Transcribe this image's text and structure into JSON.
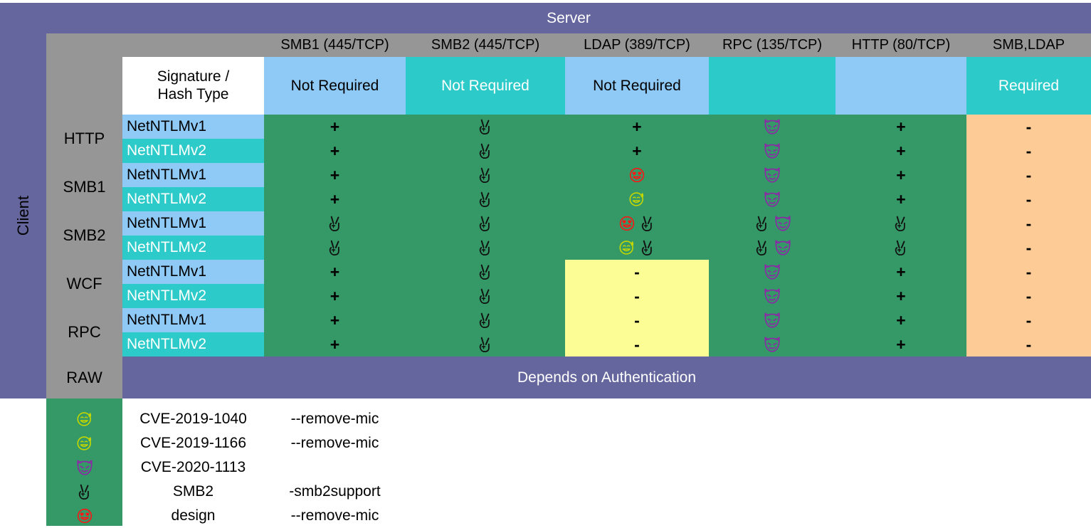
{
  "title": {
    "server": "Server",
    "client": "Client"
  },
  "columns": [
    {
      "name": "SMB1 (445/TCP)",
      "signature": "Not Required",
      "sig_style": "blue"
    },
    {
      "name": "SMB2 (445/TCP)",
      "signature": "Not Required",
      "sig_style": "teal"
    },
    {
      "name": "LDAP (389/TCP)",
      "signature": "Not Required",
      "sig_style": "blue"
    },
    {
      "name": "RPC (135/TCP)",
      "signature": "",
      "sig_style": "teal"
    },
    {
      "name": "HTTP (80/TCP)",
      "signature": "",
      "sig_style": "blue"
    },
    {
      "name": "SMB,LDAP",
      "signature": "Required",
      "sig_style": "teal"
    }
  ],
  "corner_header": {
    "line1": "Signature /",
    "line2": "Hash Type"
  },
  "row_groups": [
    {
      "label": "HTTP"
    },
    {
      "label": "SMB1"
    },
    {
      "label": "SMB2"
    },
    {
      "label": "WCF"
    },
    {
      "label": "RPC"
    },
    {
      "label": "RAW"
    }
  ],
  "hash_types": [
    "NetNTLMv1",
    "NetNTLMv2"
  ],
  "raw_row": {
    "label": "RAW",
    "text": "Depends on Authentication"
  },
  "matrix": [
    {
      "client": "HTTP",
      "hash": "NetNTLMv1",
      "cells": [
        [
          "plus"
        ],
        [
          "hand"
        ],
        [
          "plus"
        ],
        [
          "devil"
        ],
        [
          "plus"
        ],
        [
          "minus"
        ]
      ]
    },
    {
      "client": "HTTP",
      "hash": "NetNTLMv2",
      "cells": [
        [
          "plus"
        ],
        [
          "hand"
        ],
        [
          "plus"
        ],
        [
          "devil"
        ],
        [
          "plus"
        ],
        [
          "minus"
        ]
      ]
    },
    {
      "client": "SMB1",
      "hash": "NetNTLMv1",
      "cells": [
        [
          "plus"
        ],
        [
          "hand"
        ],
        [
          "heart"
        ],
        [
          "devil"
        ],
        [
          "plus"
        ],
        [
          "minus"
        ]
      ]
    },
    {
      "client": "SMB1",
      "hash": "NetNTLMv2",
      "cells": [
        [
          "plus"
        ],
        [
          "hand"
        ],
        [
          "sweat"
        ],
        [
          "devil"
        ],
        [
          "plus"
        ],
        [
          "minus"
        ]
      ]
    },
    {
      "client": "SMB2",
      "hash": "NetNTLMv1",
      "cells": [
        [
          "hand"
        ],
        [
          "hand"
        ],
        [
          "heart",
          "hand"
        ],
        [
          "hand",
          "devil"
        ],
        [
          "hand"
        ],
        [
          "minus"
        ]
      ]
    },
    {
      "client": "SMB2",
      "hash": "NetNTLMv2",
      "cells": [
        [
          "hand"
        ],
        [
          "hand"
        ],
        [
          "sweat",
          "hand"
        ],
        [
          "hand",
          "devil"
        ],
        [
          "hand"
        ],
        [
          "minus"
        ]
      ]
    },
    {
      "client": "WCF",
      "hash": "NetNTLMv1",
      "cells": [
        [
          "plus"
        ],
        [
          "hand"
        ],
        [
          "minus"
        ],
        [
          "devil"
        ],
        [
          "plus"
        ],
        [
          "minus"
        ]
      ]
    },
    {
      "client": "WCF",
      "hash": "NetNTLMv2",
      "cells": [
        [
          "plus"
        ],
        [
          "hand"
        ],
        [
          "minus"
        ],
        [
          "devil"
        ],
        [
          "plus"
        ],
        [
          "minus"
        ]
      ]
    },
    {
      "client": "RPC",
      "hash": "NetNTLMv1",
      "cells": [
        [
          "plus"
        ],
        [
          "hand"
        ],
        [
          "minus"
        ],
        [
          "devil"
        ],
        [
          "plus"
        ],
        [
          "minus"
        ]
      ]
    },
    {
      "client": "RPC",
      "hash": "NetNTLMv2",
      "cells": [
        [
          "plus"
        ],
        [
          "hand"
        ],
        [
          "minus"
        ],
        [
          "devil"
        ],
        [
          "plus"
        ],
        [
          "minus"
        ]
      ]
    }
  ],
  "marks": {
    "plus": "+",
    "minus": "-"
  },
  "legend": [
    {
      "icon": "sweat",
      "name": "CVE-2019-1040",
      "flag": "--remove-mic"
    },
    {
      "icon": "sweat",
      "name": "CVE-2019-1166",
      "flag": "--remove-mic"
    },
    {
      "icon": "devil",
      "name": "CVE-2020-1113",
      "flag": ""
    },
    {
      "icon": "hand",
      "name": "SMB2",
      "flag": "-smb2support"
    },
    {
      "icon": "heart",
      "name": "design",
      "flag": "--remove-mic"
    }
  ],
  "colors": {
    "purple": "#66669e",
    "gray": "#969696",
    "blue": "#8fc9f6",
    "teal": "#2ccac9",
    "green": "#349966",
    "orange": "#fccb96",
    "yellow": "#fdfd96",
    "icon_devil": "#8e26a8",
    "icon_sweat": "#c3d600",
    "icon_heart": "#fc1616",
    "icon_hand": "#111111"
  }
}
